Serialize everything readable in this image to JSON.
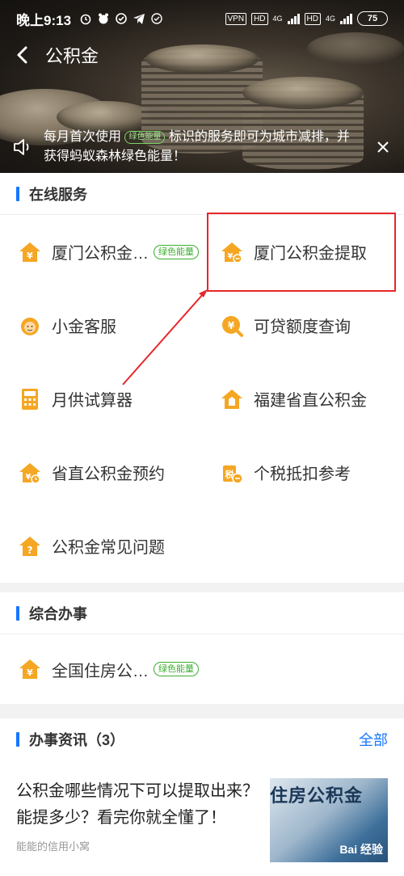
{
  "status": {
    "time": "晚上9:13",
    "vpn": "VPN",
    "hd1": "HD",
    "hd2": "HD",
    "net1": "4G",
    "net2": "4G",
    "battery": "75"
  },
  "nav": {
    "title": "公积金"
  },
  "notice": {
    "text_before": "每月首次使用",
    "badge": "绿色能量",
    "text_after": "标识的服务即可为城市减排，并获得蚂蚁森林绿色能量！"
  },
  "online": {
    "title": "在线服务",
    "items": [
      {
        "label": "厦门公积金…",
        "badge": "绿色能量"
      },
      {
        "label": "厦门公积金提取"
      },
      {
        "label": "小金客服"
      },
      {
        "label": "可贷额度查询"
      },
      {
        "label": "月供试算器"
      },
      {
        "label": "福建省直公积金"
      },
      {
        "label": "省直公积金预约"
      },
      {
        "label": "个税抵扣参考"
      },
      {
        "label": "公积金常见问题"
      }
    ]
  },
  "general": {
    "title": "综合办事",
    "items": [
      {
        "label": "全国住房公…",
        "badge": "绿色能量"
      }
    ]
  },
  "news": {
    "title": "办事资讯（3）",
    "more": "全部",
    "article": {
      "title": "公积金哪些情况下可以提取出来？能提多少？看完你就全懂了！",
      "source": "能能的信用小窝",
      "thumb_text": "住房公积金",
      "thumb_watermark": "Bai 经验"
    }
  },
  "colors": {
    "accent": "#1677ff",
    "icon_orange": "#f5a623",
    "green": "#3dae30",
    "highlight": "#e8262a"
  }
}
